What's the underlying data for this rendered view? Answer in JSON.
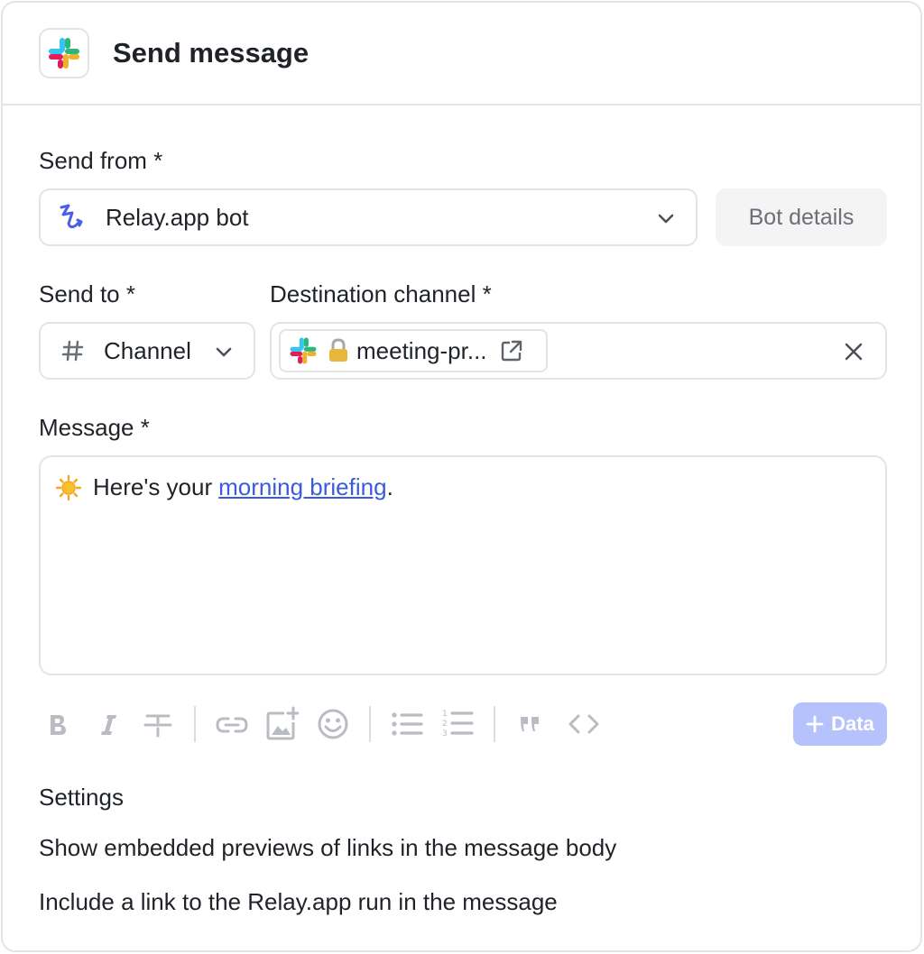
{
  "header": {
    "title": "Send message",
    "app_icon": "slack-icon"
  },
  "send_from": {
    "label": "Send from *",
    "value": "Relay.app bot",
    "icon": "relay-app-icon",
    "bot_details_label": "Bot details"
  },
  "send_to": {
    "label": "Send to *",
    "value": "Channel",
    "icon": "hash-icon"
  },
  "destination": {
    "label": "Destination channel *",
    "chip_value": "meeting-pr...",
    "chip_icons": [
      "slack-icon",
      "lock-icon",
      "external-link-icon"
    ]
  },
  "message": {
    "label": "Message *",
    "emoji": "☀️",
    "text_before": "Here's your",
    "link_text": "morning briefing",
    "text_after": "."
  },
  "toolbar": {
    "items": [
      "bold-icon",
      "italic-icon",
      "strikethrough-icon",
      "link-icon",
      "add-image-icon",
      "emoji-icon",
      "bullet-list-icon",
      "numbered-list-icon",
      "quote-icon",
      "code-icon"
    ],
    "data_button_label": "Data",
    "data_button_icon": "plus-icon"
  },
  "settings": {
    "label": "Settings",
    "items": [
      "Show embedded previews of links in the message body",
      "Include a link to the Relay.app run in the message"
    ]
  },
  "colors": {
    "accent": "#3b5bdb",
    "border": "#e4e4e7",
    "data_button": "#b6c2fb",
    "muted": "#b9bcc2"
  }
}
